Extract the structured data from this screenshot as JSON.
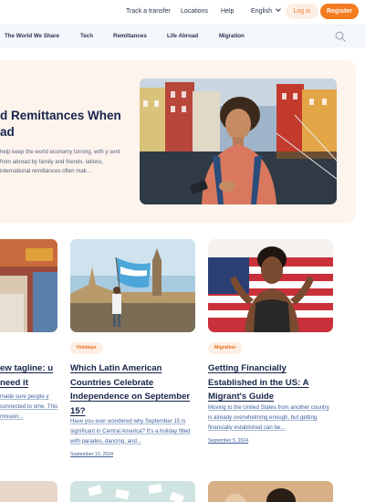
{
  "topbar": {
    "track": "Track a transfer",
    "locations": "Locations",
    "help": "Help",
    "language": "English",
    "login": "Log in",
    "register": "Register"
  },
  "nav": {
    "items": [
      "The World We Share",
      "Tech",
      "Remittances",
      "Life Abroad",
      "Migration"
    ]
  },
  "hero": {
    "title": "d Remittances When ad",
    "text": "help keep the world economy turning, with y sent from abroad by family and friends. lations, international remittances often mak..."
  },
  "cards": [
    {
      "title": "ew tagline: u need it",
      "excerpt": "made sure people y connected to ome. This mission..."
    },
    {
      "tag": "Holidays",
      "title": "Which Latin American Countries Celebrate Independence on September 15?",
      "excerpt": "Have you ever wondered why September 15 is significant in Central America? It's a holiday filled with parades, dancing, and...",
      "date": "September 10, 2024"
    },
    {
      "tag": "Migration",
      "title": "Getting Financially Established in the US: A Migrant's Guide",
      "excerpt": "Moving to the United States from another country is already overwhelming enough, but getting financially established can be...",
      "date": "September 5, 2024"
    }
  ],
  "colors": {
    "accent": "#f47b20",
    "accent_soft": "#fdeee4",
    "navy": "#16244a",
    "link": "#3f5f9a",
    "hero_bg": "#fdf4ee",
    "nav_bg": "#f3f6fa"
  }
}
